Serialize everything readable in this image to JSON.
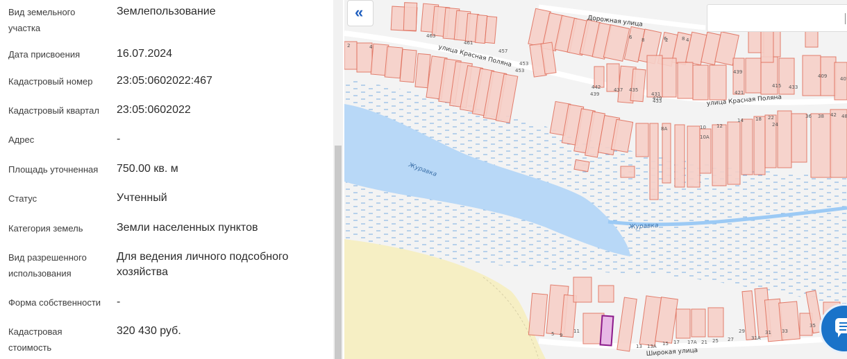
{
  "info": {
    "rows": [
      {
        "label": "Вид земельного участка",
        "value": "Землепользование"
      },
      {
        "label": "Дата присвоения",
        "value": "16.07.2024"
      },
      {
        "label": "Кадастровый номер",
        "value": "23:05:0602022:467"
      },
      {
        "label": "Кадастровый квартал",
        "value": "23:05:0602022"
      },
      {
        "label": "Адрес",
        "value": "-"
      },
      {
        "label": "Площадь уточненная",
        "value": "750.00 кв. м"
      },
      {
        "label": "Статус",
        "value": "Учтенный"
      },
      {
        "label": "Категория земель",
        "value": "Земли населенных пунктов"
      },
      {
        "label": "Вид разрешенного использования",
        "value": "Для ведения личного подсобного хозяйства"
      },
      {
        "label": "Форма собственности",
        "value": "-"
      },
      {
        "label": "Кадастровая стоимость",
        "value": "320 430 руб."
      }
    ]
  },
  "map": {
    "streets": [
      "Дорожная улица",
      "улица Красная Поляна",
      "улица Красная Поляна",
      "Широкая улица"
    ],
    "river_labels": [
      "Журавка",
      "Журавка"
    ],
    "collapse_icon": "double-chevron-left-icon",
    "chat_icon": "chat-icon",
    "parcel_numbers": [
      "463",
      "461",
      "457",
      "453",
      "453",
      "433",
      "415",
      "433",
      "409",
      "407",
      "439",
      "421",
      "437",
      "435",
      "431",
      "429",
      "442",
      "439",
      "2",
      "4",
      "6",
      "8",
      "2",
      "4",
      "6",
      "8",
      "36",
      "38",
      "42",
      "48",
      "14",
      "18",
      "22",
      "24",
      "8А",
      "10",
      "10А",
      "12",
      "5",
      "9",
      "11",
      "13",
      "13А",
      "15",
      "17",
      "17А",
      "21",
      "25",
      "27",
      "29",
      "31А",
      "31",
      "33",
      "35",
      "37",
      "39"
    ],
    "colors": {
      "parcel_fill": "#f7d0c8",
      "parcel_stroke": "#e0705d",
      "selected_stroke": "#8b1a8b",
      "water": "#b8d8f7",
      "field": "#f6efc4",
      "accent": "#1f5fbf"
    }
  }
}
